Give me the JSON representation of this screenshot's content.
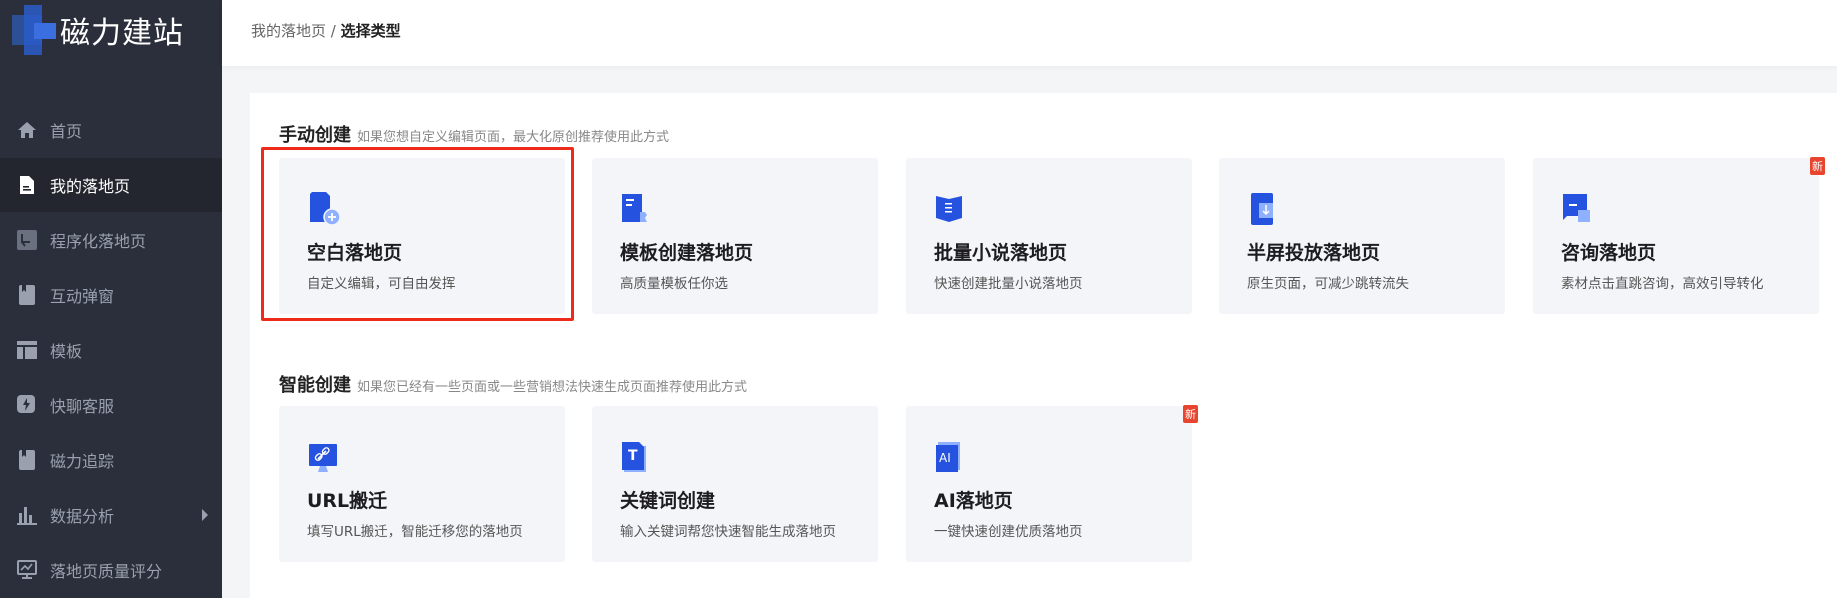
{
  "brand": "磁力建站",
  "breadcrumb": {
    "parent": "我的落地页",
    "separator": "/",
    "current": "选择类型"
  },
  "sidebar": {
    "items": [
      {
        "label": "首页",
        "icon": "home-icon"
      },
      {
        "label": "我的落地页",
        "icon": "document-icon",
        "active": true
      },
      {
        "label": "程序化落地页",
        "icon": "flow-icon"
      },
      {
        "label": "互动弹窗",
        "icon": "bookmark-icon"
      },
      {
        "label": "模板",
        "icon": "layout-icon"
      },
      {
        "label": "快聊客服",
        "icon": "lightning-chat-icon"
      },
      {
        "label": "磁力追踪",
        "icon": "bookmark-icon"
      },
      {
        "label": "数据分析",
        "icon": "bar-chart-icon"
      },
      {
        "label": "落地页质量评分",
        "icon": "monitor-icon"
      }
    ]
  },
  "sections": [
    {
      "title": "手动创建",
      "subtitle": "如果您想自定义编辑页面，最大化原创推荐使用此方式",
      "cards": [
        {
          "title": "空白落地页",
          "desc": "自定义编辑，可自由发挥",
          "icon": "blank-page-plus-icon"
        },
        {
          "title": "模板创建落地页",
          "desc": "高质量模板任你选",
          "icon": "template-icon"
        },
        {
          "title": "批量小说落地页",
          "desc": "快速创建批量小说落地页",
          "icon": "book-icon"
        },
        {
          "title": "半屏投放落地页",
          "desc": "原生页面，可减少跳转流失",
          "icon": "phone-download-icon"
        },
        {
          "title": "咨询落地页",
          "desc": "素材点击直跳咨询，高效引导转化",
          "icon": "chat-icon",
          "badge": "新"
        }
      ]
    },
    {
      "title": "智能创建",
      "subtitle": "如果您已经有一些页面或一些营销想法快速生成页面推荐使用此方式",
      "cards": [
        {
          "title": "URL搬迁",
          "desc": "填写URL搬迁，智能迁移您的落地页",
          "icon": "link-monitor-icon"
        },
        {
          "title": "关键词创建",
          "desc": "输入关键词帮您快速智能生成落地页",
          "icon": "text-doc-icon",
          "icon_text": "T"
        },
        {
          "title": "AI落地页",
          "desc": "一键快速创建优质落地页",
          "icon": "ai-icon",
          "icon_text": "AI",
          "badge": "新"
        }
      ]
    }
  ],
  "colors": {
    "sidebar": "#2b2f3b",
    "accent": "#2d5be3",
    "highlight": "#ee2a1a",
    "badge": "#e8452e"
  }
}
